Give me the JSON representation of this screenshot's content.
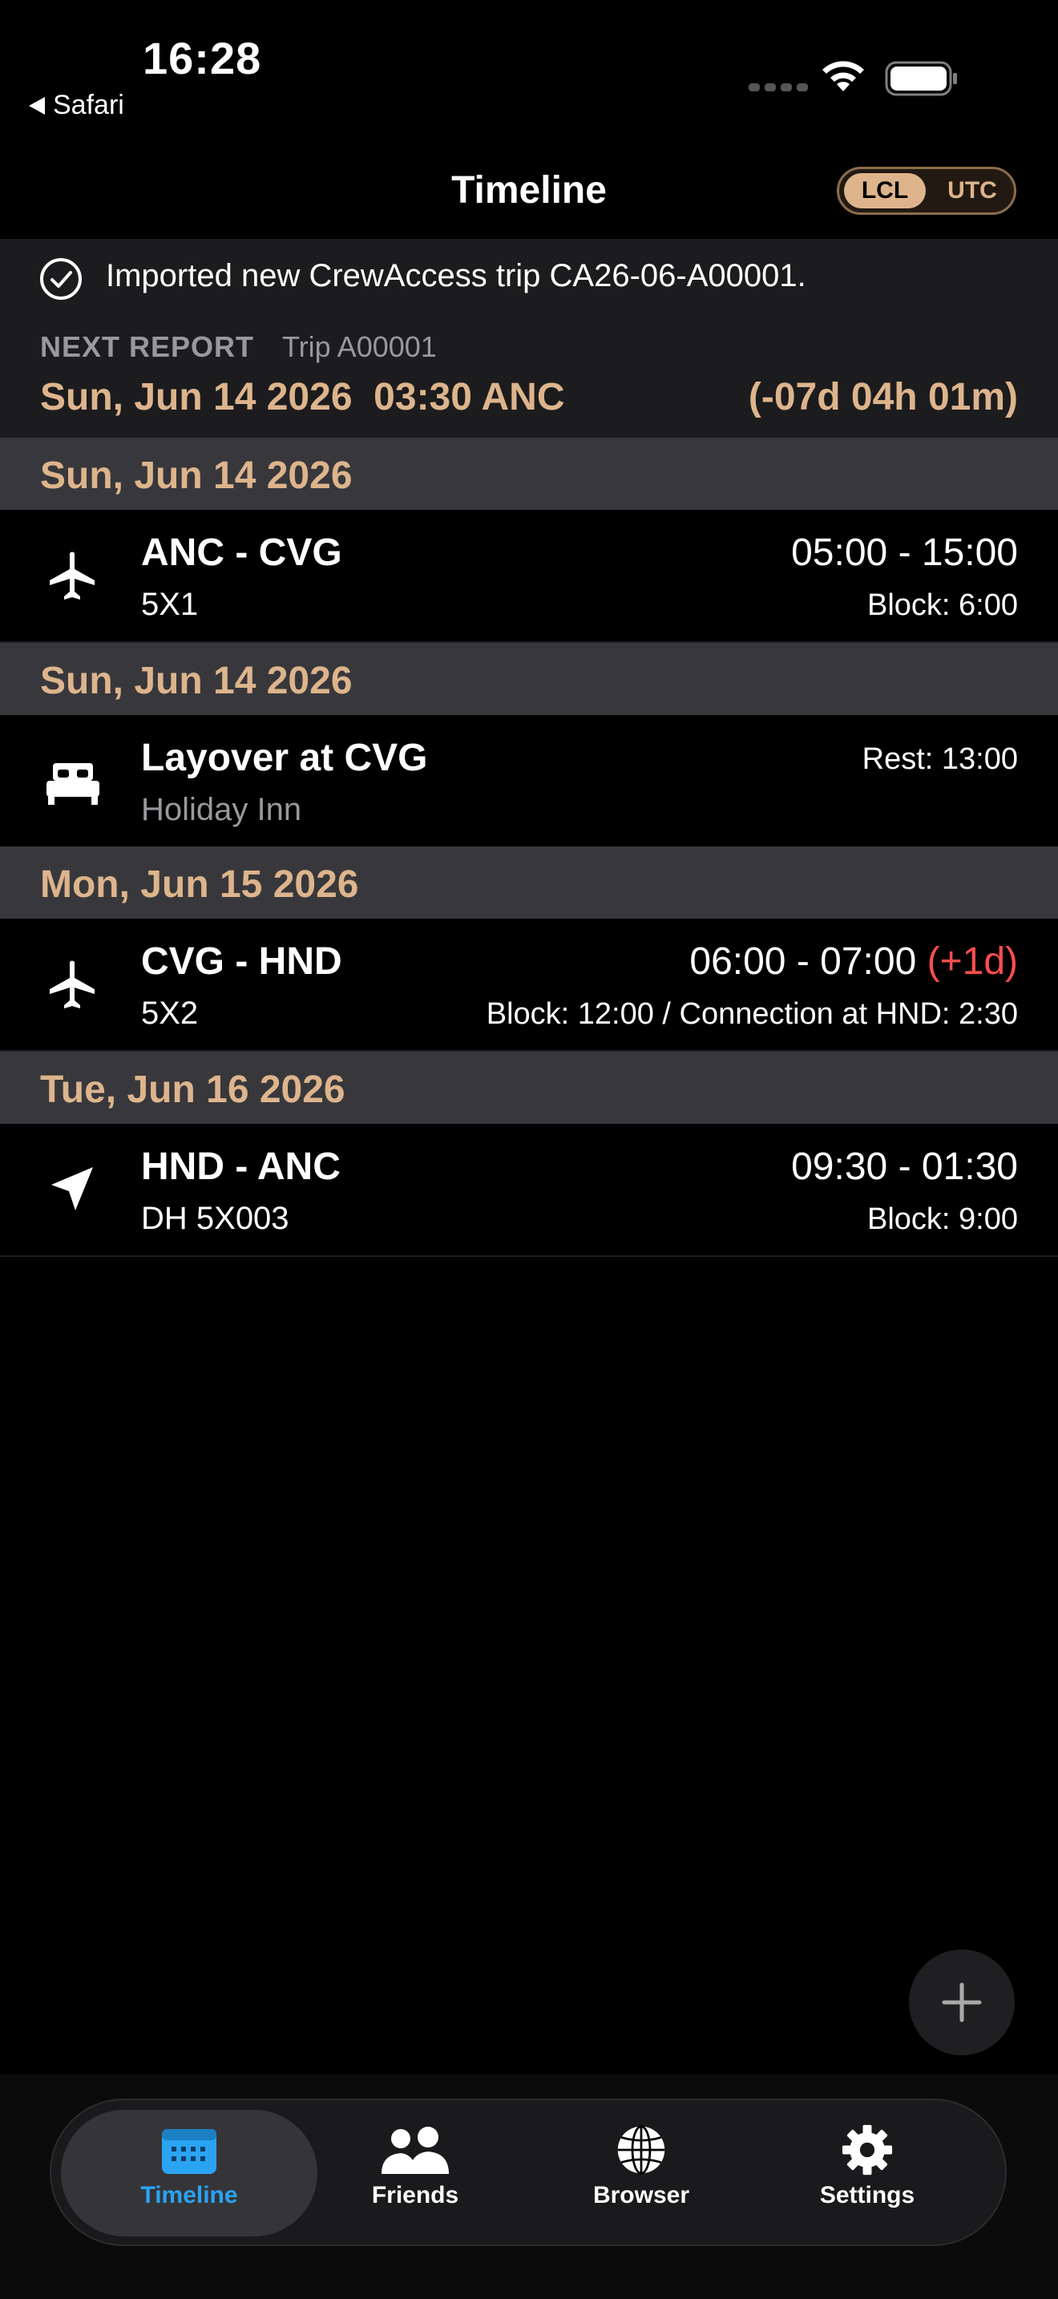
{
  "status_bar": {
    "time": "16:28",
    "back_app": "Safari"
  },
  "header": {
    "title": "Timeline",
    "tz_options": [
      "LCL",
      "UTC"
    ],
    "tz_selected": "LCL"
  },
  "notice": {
    "text": "Imported new CrewAccess trip CA26-06-A00001."
  },
  "next_report": {
    "label": "NEXT REPORT",
    "trip": "Trip A00001",
    "datetime": "Sun, Jun 14 2026  03:30 ANC",
    "countdown": "(-07d 04h 01m)"
  },
  "timeline": [
    {
      "date": "Sun, Jun 14 2026",
      "icon": "airplane-icon",
      "title": "ANC - CVG",
      "subtitle": "5X1",
      "time": "05:00 - 15:00",
      "time_extra": "",
      "detail": "Block: 6:00"
    },
    {
      "date": "Sun, Jun 14 2026",
      "icon": "bed-icon",
      "title": "Layover at CVG",
      "subtitle": "Holiday Inn",
      "detail": "Rest: 13:00"
    },
    {
      "date": "Mon, Jun 15 2026",
      "icon": "airplane-icon",
      "title": "CVG - HND",
      "subtitle": "5X2",
      "time": "06:00 - 07:00 ",
      "time_extra": "(+1d)",
      "detail": "Block: 12:00 / Connection at HND: 2:30"
    },
    {
      "date": "Tue, Jun 16 2026",
      "icon": "location-arrow-icon",
      "title": "HND - ANC",
      "subtitle": "DH 5X003",
      "time": "09:30 - 01:30",
      "time_extra": "",
      "detail": "Block: 9:00"
    }
  ],
  "tabs": [
    {
      "label": "Timeline",
      "icon": "calendar-icon",
      "active": true
    },
    {
      "label": "Friends",
      "icon": "people-icon",
      "active": false
    },
    {
      "label": "Browser",
      "icon": "globe-icon",
      "active": false
    },
    {
      "label": "Settings",
      "icon": "gear-icon",
      "active": false
    }
  ],
  "colors": {
    "accent": "#ddb48c",
    "day_header_bg": "#38383c",
    "active_tab": "#2aa3f3",
    "next_day": "#ff4d4d"
  }
}
